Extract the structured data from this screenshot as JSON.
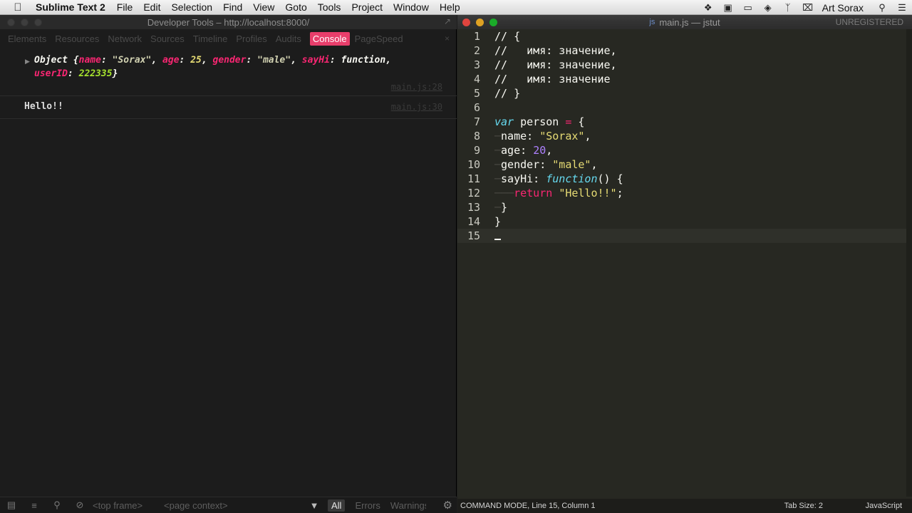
{
  "menubar": {
    "app_name": "Sublime Text 2",
    "items": [
      "File",
      "Edit",
      "Selection",
      "Find",
      "View",
      "Goto",
      "Tools",
      "Project",
      "Window",
      "Help"
    ],
    "user": "Art Sorax"
  },
  "devtools": {
    "title": "Developer Tools – http://localhost:8000/",
    "tabs": [
      "Elements",
      "Resources",
      "Network",
      "Sources",
      "Timeline",
      "Profiles",
      "Audits",
      "Console",
      "PageSpeed"
    ],
    "active_tab": "Console",
    "console": {
      "object_log": {
        "prefix": "Object {",
        "name_key": "name",
        "name_value": "\"Sorax\"",
        "age_key": "age",
        "age_value": "25",
        "gender_key": "gender",
        "gender_value": "\"male\"",
        "sayhi_key": "sayHi",
        "sayhi_value": "function",
        "userid_key": "userID",
        "userid_value": "222335",
        "suffix": "}",
        "source": "main.js:28"
      },
      "string_log": {
        "text": "Hello!!",
        "source": "main.js:30"
      }
    },
    "bottom": {
      "frame": "<top frame>",
      "context": "<page context>",
      "levels": [
        "All",
        "Errors",
        "Warnings"
      ],
      "active_level": "All"
    }
  },
  "sublime": {
    "title": "main.js — jstut",
    "unregistered": "UNREGISTERED",
    "file_type": "js",
    "line_numbers": [
      "1",
      "2",
      "3",
      "4",
      "5",
      "6",
      "7",
      "8",
      "9",
      "10",
      "11",
      "12",
      "13",
      "14",
      "15"
    ],
    "code": {
      "l1": "// {",
      "l2": "//   имя: значение,",
      "l3": "//   имя: значение,",
      "l4": "//   имя: значение",
      "l5": "// }",
      "l7_kw": "var",
      "l7_name": "person",
      "l7_op": "=",
      "l7_brace": "{",
      "l8_prop": "name:",
      "l8_val": "\"Sorax\"",
      "l9_prop": "age:",
      "l9_val": "20",
      "l10_prop": "gender:",
      "l10_val": "\"male\"",
      "l11_prop": "sayHi:",
      "l11_fn": "function",
      "l11_rest": "() {",
      "l12_ret": "return",
      "l12_val": "\"Hello!!\"",
      "l13": "}",
      "l14": "}"
    },
    "status": {
      "mode": "COMMAND MODE, Line 15, Column 1",
      "tab_size": "Tab Size: 2",
      "syntax": "JavaScript"
    }
  }
}
